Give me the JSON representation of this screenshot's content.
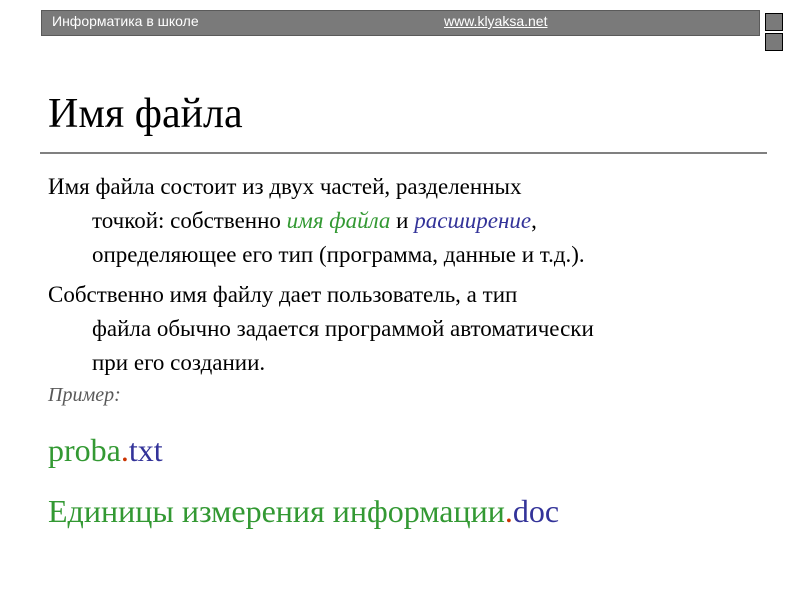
{
  "header": {
    "site_name": "Информатика в школе",
    "url": "www.klyaksa.net"
  },
  "slide": {
    "title": "Имя файла",
    "paragraph1": {
      "line1": "Имя файла состоит из двух частей, разделенных",
      "line2_prefix": "точкой: собственно ",
      "term_name": "имя файла",
      "line2_mid": " и ",
      "term_ext": "расширение",
      "line2_suffix": ",",
      "line3": "определяющее его тип (программа, данные и т.д.)."
    },
    "paragraph2": {
      "line1": "Собственно имя файлу дает пользователь, а тип",
      "line2": "файла обычно задается программой автоматически",
      "line3": "при его создании."
    },
    "example_label": "Пример:",
    "examples": [
      {
        "name": "proba",
        "dot": ".",
        "ext": "txt"
      },
      {
        "name": "Единицы измерения информации",
        "dot": ".",
        "ext": "doc"
      }
    ]
  },
  "colors": {
    "filename": "#339933",
    "extension": "#333399",
    "dot": "#cc3300",
    "header_band": "#7a7a7a"
  }
}
